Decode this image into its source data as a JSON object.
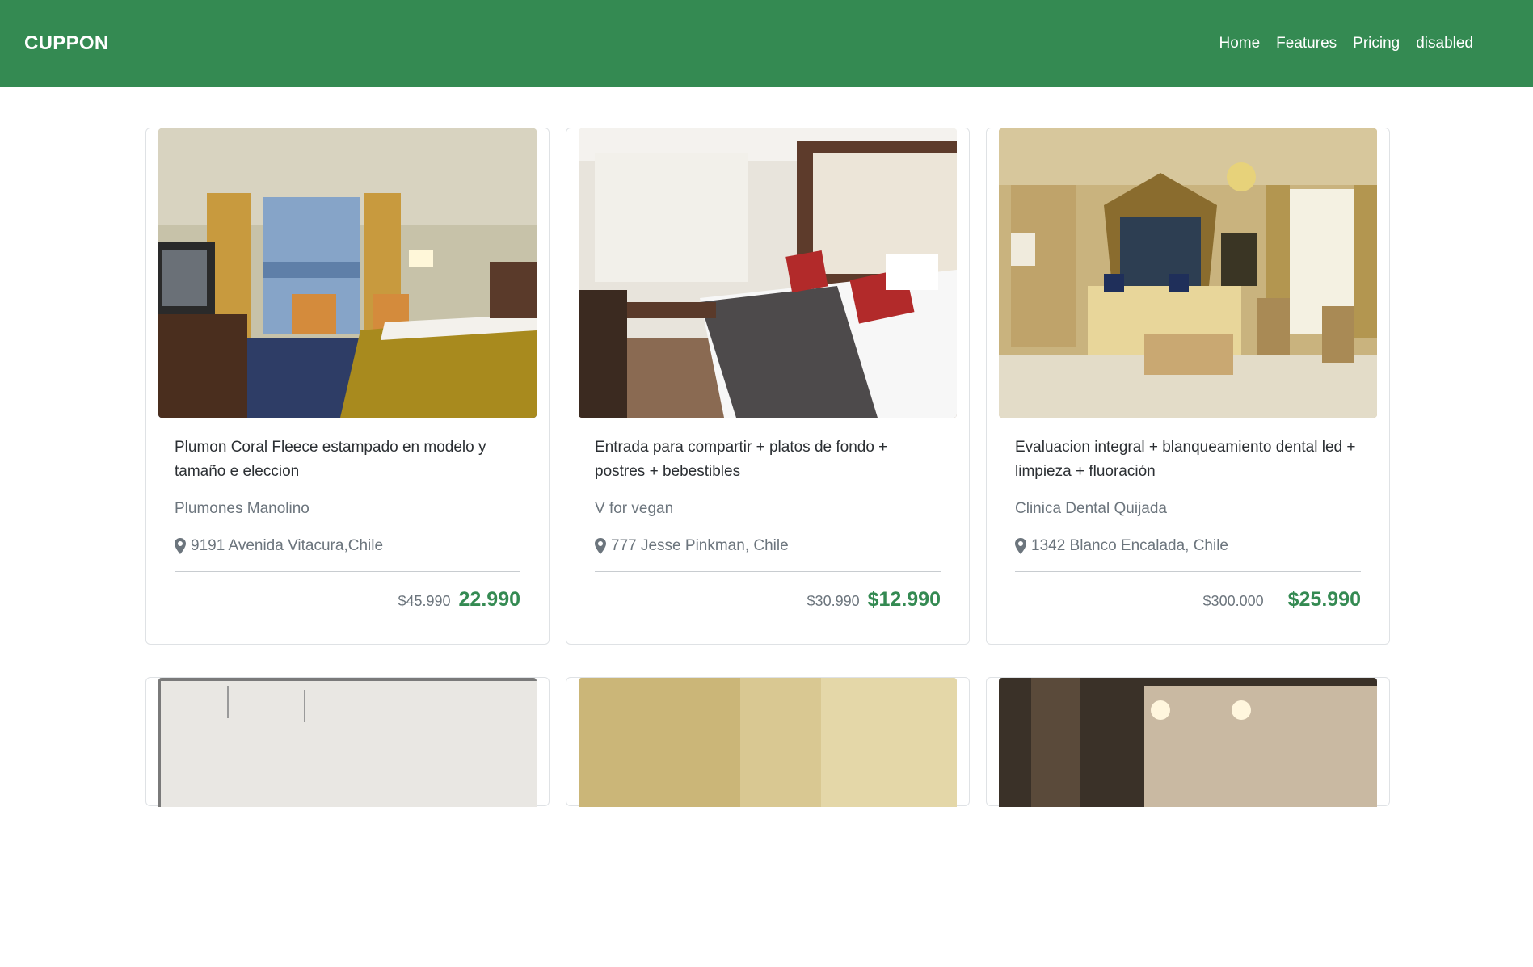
{
  "navbar": {
    "brand": "CUPPON",
    "links": [
      "Home",
      "Features",
      "Pricing",
      "disabled"
    ]
  },
  "cards": [
    {
      "title": "Plumon Coral Fleece estampado en modelo y tamaño e eleccion",
      "vendor": "Plumones Manolino",
      "location": "9191 Avenida Vitacura,Chile",
      "old_price": "$45.990",
      "new_price": "22.990"
    },
    {
      "title": "Entrada para compartir + platos de fondo + postres + bebestibles",
      "vendor": "V for vegan",
      "location": "777 Jesse Pinkman, Chile",
      "old_price": "$30.990",
      "new_price": "$12.990"
    },
    {
      "title": "Evaluacion integral + blanqueamiento dental led + limpieza + fluoración",
      "vendor": "Clinica Dental Quijada",
      "location": "1342 Blanco Encalada, Chile",
      "old_price": "$300.000",
      "new_price": "$25.990"
    }
  ],
  "colors": {
    "brand_green": "#348a52",
    "muted": "#6c757d"
  },
  "icons": {
    "location": "map-marker-icon"
  }
}
